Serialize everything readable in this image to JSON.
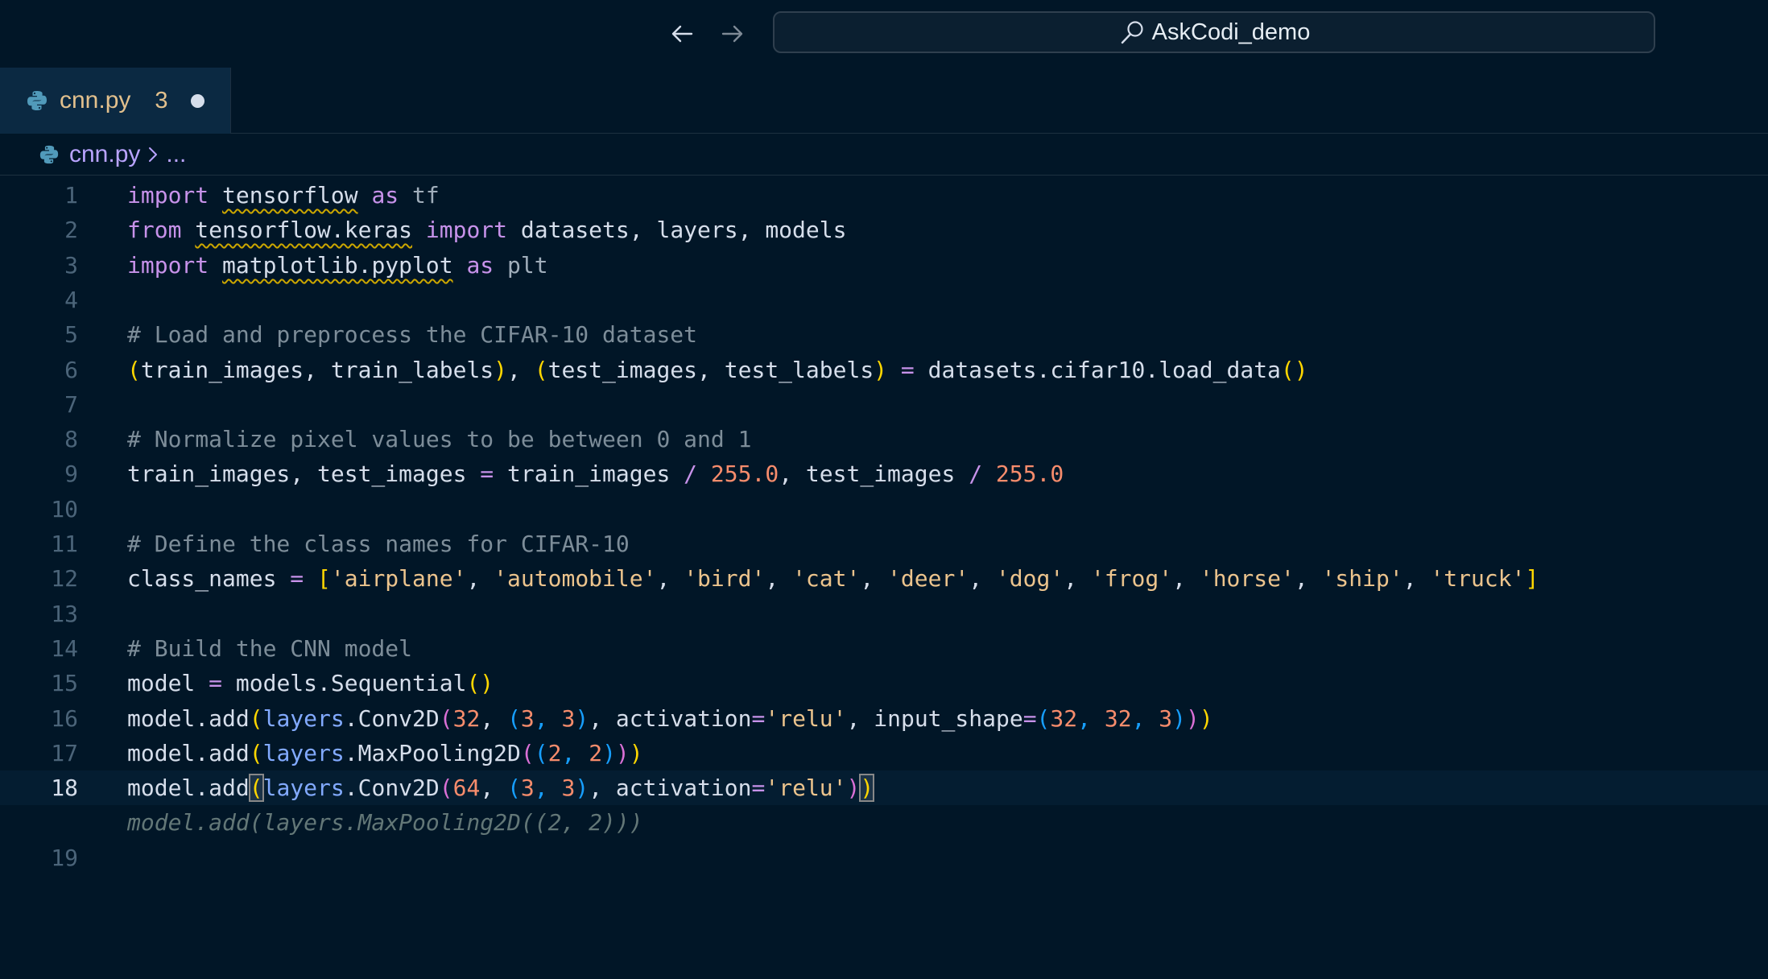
{
  "nav": {
    "back_icon": "arrow-left-icon",
    "forward_icon": "arrow-right-icon"
  },
  "search": {
    "icon": "search-icon",
    "text": "AskCodi_demo"
  },
  "tab": {
    "icon": "python-icon",
    "filename": "cnn.py",
    "problems_count": "3",
    "dirty_indicator": "unsaved-dot-icon"
  },
  "breadcrumb": {
    "icon": "python-icon",
    "file": "cnn.py",
    "separator_icon": "chevron-right-icon",
    "more": "..."
  },
  "editor": {
    "active_line": 18,
    "lines": [
      {
        "no": "1",
        "tokens": [
          [
            "kw",
            "import"
          ],
          [
            "plain",
            " "
          ],
          [
            "mod",
            "tensorflow"
          ],
          [
            "plain",
            " "
          ],
          [
            "kw",
            "as"
          ],
          [
            "plain",
            " "
          ],
          [
            "alias",
            "tf"
          ]
        ]
      },
      {
        "no": "2",
        "tokens": [
          [
            "kw",
            "from"
          ],
          [
            "plain",
            " "
          ],
          [
            "mod",
            "tensorflow.keras"
          ],
          [
            "plain",
            " "
          ],
          [
            "kw",
            "import"
          ],
          [
            "plain",
            " datasets, layers, models"
          ]
        ]
      },
      {
        "no": "3",
        "tokens": [
          [
            "kw",
            "import"
          ],
          [
            "plain",
            " "
          ],
          [
            "mod",
            "matplotlib.pyplot"
          ],
          [
            "plain",
            " "
          ],
          [
            "kw",
            "as"
          ],
          [
            "plain",
            " "
          ],
          [
            "alias",
            "plt"
          ]
        ]
      },
      {
        "no": "4",
        "tokens": []
      },
      {
        "no": "5",
        "tokens": [
          [
            "cmt",
            "# Load and preprocess the CIFAR-10 dataset"
          ]
        ]
      },
      {
        "no": "6",
        "tokens": [
          [
            "b1",
            "("
          ],
          [
            "plain",
            "train_images, train_labels"
          ],
          [
            "b1",
            ")"
          ],
          [
            "plain",
            ", "
          ],
          [
            "b1",
            "("
          ],
          [
            "plain",
            "test_images, test_labels"
          ],
          [
            "b1",
            ")"
          ],
          [
            "plain",
            " "
          ],
          [
            "op",
            "="
          ],
          [
            "plain",
            " datasets.cifar10."
          ],
          [
            "fn2",
            "load_data"
          ],
          [
            "b1",
            "()"
          ]
        ]
      },
      {
        "no": "7",
        "tokens": []
      },
      {
        "no": "8",
        "tokens": [
          [
            "cmt",
            "# Normalize pixel values to be between 0 and 1"
          ]
        ]
      },
      {
        "no": "9",
        "tokens": [
          [
            "plain",
            "train_images, test_images "
          ],
          [
            "op",
            "="
          ],
          [
            "plain",
            " train_images "
          ],
          [
            "op",
            "/"
          ],
          [
            "plain",
            " "
          ],
          [
            "num",
            "255.0"
          ],
          [
            "plain",
            ", test_images "
          ],
          [
            "op",
            "/"
          ],
          [
            "plain",
            " "
          ],
          [
            "num",
            "255.0"
          ]
        ]
      },
      {
        "no": "10",
        "tokens": []
      },
      {
        "no": "11",
        "tokens": [
          [
            "cmt",
            "# Define the class names for CIFAR-10"
          ]
        ]
      },
      {
        "no": "12",
        "tokens": [
          [
            "plain",
            "class_names "
          ],
          [
            "op",
            "="
          ],
          [
            "plain",
            " "
          ],
          [
            "b1",
            "["
          ],
          [
            "str",
            "'airplane'"
          ],
          [
            "plain",
            ", "
          ],
          [
            "str",
            "'automobile'"
          ],
          [
            "plain",
            ", "
          ],
          [
            "str",
            "'bird'"
          ],
          [
            "plain",
            ", "
          ],
          [
            "str",
            "'cat'"
          ],
          [
            "plain",
            ", "
          ],
          [
            "str",
            "'deer'"
          ],
          [
            "plain",
            ", "
          ],
          [
            "str",
            "'dog'"
          ],
          [
            "plain",
            ", "
          ],
          [
            "str",
            "'frog'"
          ],
          [
            "plain",
            ", "
          ],
          [
            "str",
            "'horse'"
          ],
          [
            "plain",
            ", "
          ],
          [
            "str",
            "'ship'"
          ],
          [
            "plain",
            ", "
          ],
          [
            "str",
            "'truck'"
          ],
          [
            "b1",
            "]"
          ]
        ]
      },
      {
        "no": "13",
        "tokens": []
      },
      {
        "no": "14",
        "tokens": [
          [
            "cmt",
            "# Build the CNN model"
          ]
        ]
      },
      {
        "no": "15",
        "tokens": [
          [
            "plain",
            "model "
          ],
          [
            "op",
            "="
          ],
          [
            "plain",
            " models."
          ],
          [
            "fn2",
            "Sequential"
          ],
          [
            "b1",
            "()"
          ]
        ]
      },
      {
        "no": "16",
        "tokens": [
          [
            "plain",
            "model."
          ],
          [
            "fn2",
            "add"
          ],
          [
            "b1",
            "("
          ],
          [
            "fn",
            "layers"
          ],
          [
            "plain",
            "."
          ],
          [
            "fn2",
            "Conv2D"
          ],
          [
            "b2",
            "("
          ],
          [
            "num",
            "32"
          ],
          [
            "plain",
            ", "
          ],
          [
            "b3",
            "("
          ],
          [
            "num",
            "3"
          ],
          [
            "b3",
            ", "
          ],
          [
            "num",
            "3"
          ],
          [
            "b3",
            ")"
          ],
          [
            "plain",
            ", activation"
          ],
          [
            "op",
            "="
          ],
          [
            "str",
            "'relu'"
          ],
          [
            "plain",
            ", input_shape"
          ],
          [
            "op",
            "="
          ],
          [
            "b3",
            "("
          ],
          [
            "num",
            "32"
          ],
          [
            "b3",
            ", "
          ],
          [
            "num",
            "32"
          ],
          [
            "b3",
            ", "
          ],
          [
            "num",
            "3"
          ],
          [
            "b3",
            ")"
          ],
          [
            "b2",
            ")"
          ],
          [
            "b1",
            ")"
          ]
        ]
      },
      {
        "no": "17",
        "tokens": [
          [
            "plain",
            "model."
          ],
          [
            "fn2",
            "add"
          ],
          [
            "b1",
            "("
          ],
          [
            "fn",
            "layers"
          ],
          [
            "plain",
            "."
          ],
          [
            "fn2",
            "MaxPooling2D"
          ],
          [
            "b2",
            "("
          ],
          [
            "b3",
            "("
          ],
          [
            "num",
            "2"
          ],
          [
            "b3",
            ", "
          ],
          [
            "num",
            "2"
          ],
          [
            "b3",
            ")"
          ],
          [
            "b2",
            ")"
          ],
          [
            "b1",
            ")"
          ]
        ]
      },
      {
        "no": "18",
        "tokens": [
          [
            "plain",
            "model."
          ],
          [
            "fn2",
            "add"
          ],
          [
            "b1m",
            "("
          ],
          [
            "fn",
            "layers"
          ],
          [
            "plain",
            "."
          ],
          [
            "fn2",
            "Conv2D"
          ],
          [
            "b2",
            "("
          ],
          [
            "num",
            "64"
          ],
          [
            "plain",
            ", "
          ],
          [
            "b3",
            "("
          ],
          [
            "num",
            "3"
          ],
          [
            "b3",
            ", "
          ],
          [
            "num",
            "3"
          ],
          [
            "b3",
            ")"
          ],
          [
            "plain",
            ", activation"
          ],
          [
            "op",
            "="
          ],
          [
            "str",
            "'relu'"
          ],
          [
            "b2",
            ")"
          ],
          [
            "b1m",
            ")"
          ]
        ]
      },
      {
        "no": "",
        "tokens": [
          [
            "ghost",
            "model.add(layers.MaxPooling2D((2, 2)))"
          ]
        ]
      },
      {
        "no": "19",
        "tokens": []
      }
    ]
  }
}
